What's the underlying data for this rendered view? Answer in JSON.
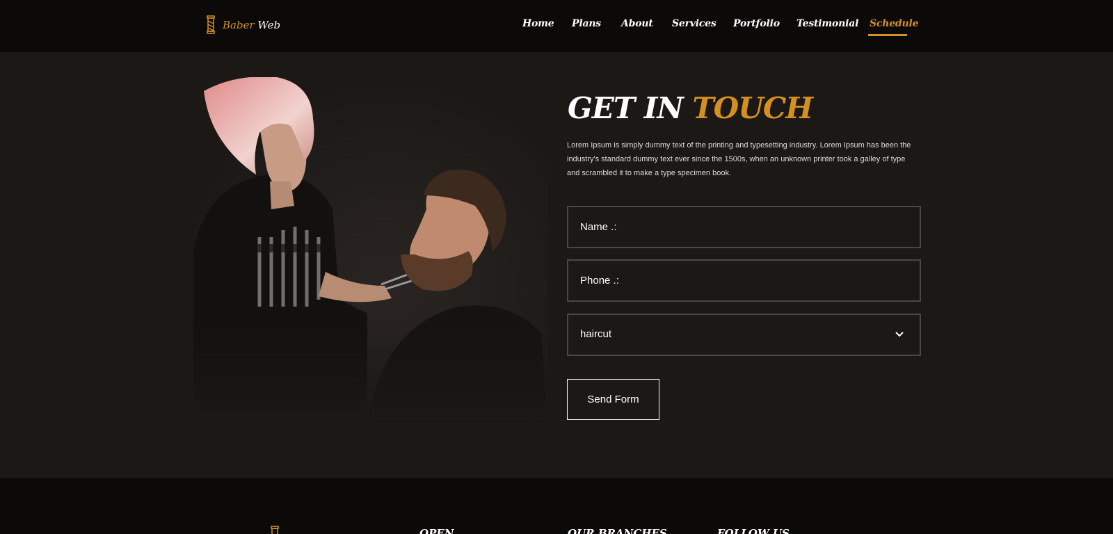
{
  "header": {
    "logo": {
      "word1": "Baber",
      "word2": "Web",
      "icon": "barber-pole-icon"
    },
    "nav": [
      {
        "label": "Home"
      },
      {
        "label": "Plans"
      },
      {
        "label": "About"
      },
      {
        "label": "Services"
      },
      {
        "label": "Portfolio"
      },
      {
        "label": "Testimonial"
      },
      {
        "label": "Schedule",
        "active": true
      }
    ]
  },
  "contact": {
    "title_white": "GET IN",
    "title_gold": "TOUCH",
    "description": "Lorem Ipsum is simply dummy text of the printing and typesetting industry. Lorem Ipsum has been the industry's standard dummy text ever since the 1500s, when an unknown printer took a galley of type and scrambled it to make a type specimen book.",
    "name_placeholder": "Name .:",
    "phone_placeholder": "Phone .:",
    "service_selected": "haircut",
    "send_label": "Send Form"
  },
  "footer": {
    "headings": [
      "OPEN",
      "OUR BRANCHES",
      "FOLLOW US"
    ]
  },
  "colors": {
    "accent": "#d4901f",
    "header_bg": "#0b0a09",
    "page_bg": "#1b1816"
  }
}
